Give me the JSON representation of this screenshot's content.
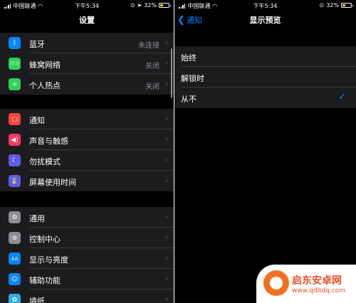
{
  "status_bar": {
    "left": {
      "carrier": "中国联通",
      "time": "下午5:34",
      "battery": "32%",
      "battery_level": 0.32
    },
    "right": {
      "carrier": "中国联通",
      "time": "下午5:34",
      "battery": "32%",
      "battery_level": 0.32
    }
  },
  "settings": {
    "title": "设置",
    "groups": [
      [
        {
          "label": "蓝牙",
          "value": "未连接",
          "icon": "bluetooth-icon",
          "color": "#0a84ff"
        },
        {
          "label": "蜂窝网络",
          "value": "关闭",
          "icon": "antenna-icon",
          "color": "#30d158"
        },
        {
          "label": "个人热点",
          "value": "关闭",
          "icon": "hotspot-icon",
          "color": "#30d158"
        }
      ],
      [
        {
          "label": "通知",
          "value": "",
          "icon": "notification-icon",
          "color": "#ff453a"
        },
        {
          "label": "声音与触感",
          "value": "",
          "icon": "speaker-icon",
          "color": "#ff375f"
        },
        {
          "label": "勿扰模式",
          "value": "",
          "icon": "moon-icon",
          "color": "#5e5ce6"
        },
        {
          "label": "屏幕使用时间",
          "value": "",
          "icon": "hourglass-icon",
          "color": "#5e5ce6"
        }
      ],
      [
        {
          "label": "通用",
          "value": "",
          "icon": "gear-icon",
          "color": "#8e8e93"
        },
        {
          "label": "控制中心",
          "value": "",
          "icon": "toggles-icon",
          "color": "#8e8e93"
        },
        {
          "label": "显示与亮度",
          "value": "",
          "icon": "text-size-icon",
          "color": "#0a84ff"
        },
        {
          "label": "辅助功能",
          "value": "",
          "icon": "accessibility-icon",
          "color": "#0a84ff"
        },
        {
          "label": "墙纸",
          "value": "",
          "icon": "flower-icon",
          "color": "#32ade6"
        }
      ]
    ]
  },
  "preview": {
    "back_label": "通知",
    "title": "显示预览",
    "options": [
      {
        "label": "始终",
        "selected": false
      },
      {
        "label": "解锁时",
        "selected": false
      },
      {
        "label": "从不",
        "selected": true
      }
    ],
    "check_mark": "✓"
  },
  "watermark": {
    "name": "启东安卓网",
    "url": "www.qdltdq.com"
  }
}
